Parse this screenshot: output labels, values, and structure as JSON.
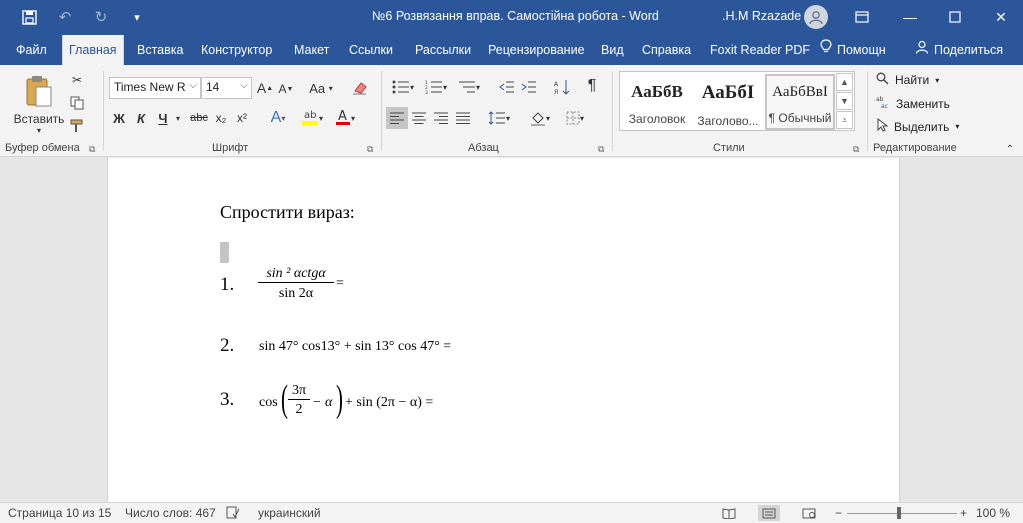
{
  "titlebar": {
    "doc_title": "№6 Розвязання вправ. Самостійна робота  -  Word",
    "user_name": ".H.M Rzazade",
    "save_icon": "save-icon",
    "undo_icon": "undo-icon",
    "redo_icon": "redo-icon",
    "customize_icon": "customize-qat-icon"
  },
  "tabs": [
    "Файл",
    "Главная",
    "Вставка",
    "Конструктор",
    "Макет",
    "Ссылки",
    "Рассылки",
    "Рецензирование",
    "Вид",
    "Справка",
    "Foxit Reader PDF"
  ],
  "tabs_right": {
    "help": "Помощн",
    "share": "Поделиться"
  },
  "ribbon": {
    "clipboard": {
      "paste": "Вставить",
      "label": "Буфер обмена"
    },
    "font": {
      "name": "Times New R",
      "size": "14",
      "label": "Шрифт",
      "change_case": "Aa",
      "bold": "Ж",
      "italic": "К",
      "underline": "Ч",
      "strike": "abc",
      "subscript": "x₂",
      "superscript": "x²",
      "grow": "A",
      "shrink": "A",
      "effects": "A",
      "color": "A"
    },
    "paragraph": {
      "label": "Абзац",
      "pilcrow": "¶"
    },
    "styles": {
      "label": "Стили",
      "items": [
        {
          "sample": "АаБбВ",
          "name": "Заголовок"
        },
        {
          "sample": "АаБбI",
          "name": "Заголово..."
        },
        {
          "sample": "АаБбВвI",
          "name": "¶ Обычный"
        }
      ]
    },
    "editing": {
      "label": "Редактирование",
      "find": "Найти",
      "replace": "Заменить",
      "select": "Выделить"
    }
  },
  "document": {
    "heading": "Спростити вираз:",
    "items": [
      {
        "number": "1.",
        "numerator": "sin ² αctgα",
        "denominator": "sin 2α",
        "tail": "="
      },
      {
        "number": "2.",
        "expr": "sin 47° cos13° + sin 13° cos 47° ="
      },
      {
        "number": "3.",
        "prefix": "cos",
        "frac_num": "3π",
        "frac_den": "2",
        "after_frac": "− α",
        "tail": "+ sin (2π − α) ="
      }
    ]
  },
  "statusbar": {
    "page": "Страница 10 из 15",
    "words": "Число слов: 467",
    "language": "украинский",
    "zoom": "100 %",
    "zoom_percent": 100
  },
  "colors": {
    "brand": "#2b579a",
    "ribbon_bg": "#f3f3f3",
    "highlight": "#ffff00",
    "font_color": "#e00000"
  }
}
